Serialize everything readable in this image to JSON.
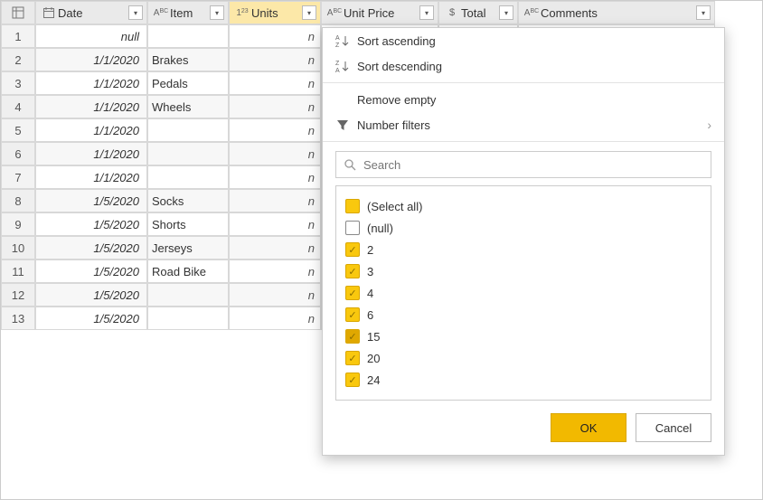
{
  "columns": {
    "date": {
      "label": "Date",
      "type_icon": "date"
    },
    "item": {
      "label": "Item",
      "type_icon": "text"
    },
    "units": {
      "label": "Units",
      "type_icon": "number"
    },
    "price": {
      "label": "Unit Price",
      "type_icon": "text"
    },
    "total": {
      "label": "Total",
      "type_icon": "money"
    },
    "comm": {
      "label": "Comments",
      "type_icon": "text"
    }
  },
  "rows": [
    {
      "n": "1",
      "date": "null",
      "item": ""
    },
    {
      "n": "2",
      "date": "1/1/2020",
      "item": "Brakes"
    },
    {
      "n": "3",
      "date": "1/1/2020",
      "item": "Pedals"
    },
    {
      "n": "4",
      "date": "1/1/2020",
      "item": "Wheels"
    },
    {
      "n": "5",
      "date": "1/1/2020",
      "item": ""
    },
    {
      "n": "6",
      "date": "1/1/2020",
      "item": ""
    },
    {
      "n": "7",
      "date": "1/1/2020",
      "item": ""
    },
    {
      "n": "8",
      "date": "1/5/2020",
      "item": "Socks"
    },
    {
      "n": "9",
      "date": "1/5/2020",
      "item": "Shorts"
    },
    {
      "n": "10",
      "date": "1/5/2020",
      "item": "Jerseys"
    },
    {
      "n": "11",
      "date": "1/5/2020",
      "item": "Road Bike"
    },
    {
      "n": "12",
      "date": "1/5/2020",
      "item": ""
    },
    {
      "n": "13",
      "date": "1/5/2020",
      "item": ""
    }
  ],
  "units_peek": "n",
  "filter_popup": {
    "sort_asc": "Sort ascending",
    "sort_desc": "Sort descending",
    "remove_empty": "Remove empty",
    "number_filters": "Number filters",
    "search_placeholder": "Search",
    "select_all": "(Select all)",
    "null_option": "(null)",
    "values": [
      "2",
      "3",
      "4",
      "6",
      "15",
      "20",
      "24"
    ],
    "ok": "OK",
    "cancel": "Cancel"
  }
}
